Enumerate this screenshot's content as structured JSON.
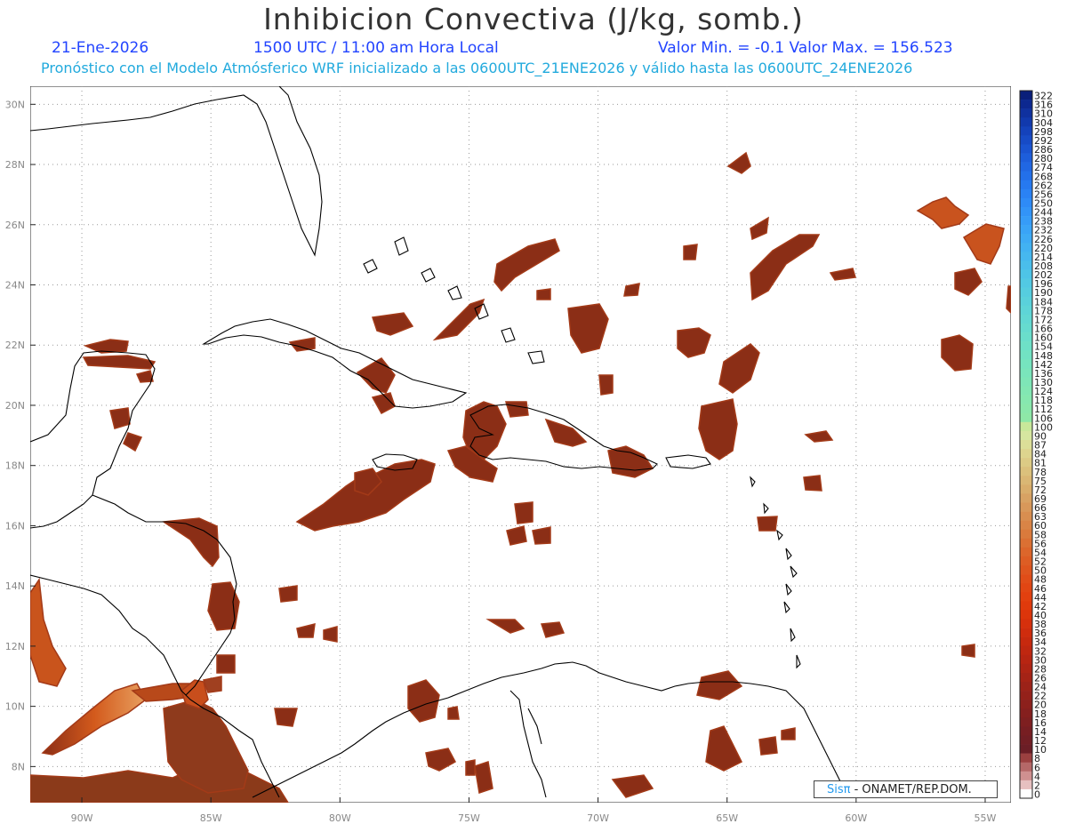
{
  "header": {
    "title": "Inhibicion Convectiva (J/kg, somb.)",
    "date": "21-Ene-2026",
    "time": "1500 UTC / 11:00 am Hora Local",
    "minmax": "Valor Min. = -0.1  Valor Max. = 156.523",
    "subtitle": "Pronóstico con el Modelo Atmósferico WRF inicializado a las 0600UTC_21ENE2026 y válido hasta las  0600UTC_24ENE2026"
  },
  "map": {
    "lon_labels": [
      "90W",
      "85W",
      "80W",
      "75W",
      "70W",
      "65W",
      "60W",
      "55W"
    ],
    "lon_values": [
      -90,
      -85,
      -80,
      -75,
      -70,
      -65,
      -60,
      -55
    ],
    "lat_labels": [
      "8N",
      "10N",
      "12N",
      "14N",
      "16N",
      "18N",
      "20N",
      "22N",
      "24N",
      "26N",
      "28N",
      "30N"
    ],
    "lat_values": [
      8,
      10,
      12,
      14,
      16,
      18,
      20,
      22,
      24,
      26,
      28,
      30
    ],
    "lon_range": [
      -92,
      -54
    ],
    "lat_range": [
      6.8,
      30.6
    ],
    "grid": "dotted"
  },
  "legend": {
    "labels": [
      "322",
      "316",
      "310",
      "304",
      "298",
      "292",
      "286",
      "280",
      "274",
      "268",
      "262",
      "256",
      "250",
      "244",
      "238",
      "232",
      "226",
      "220",
      "214",
      "208",
      "202",
      "196",
      "190",
      "184",
      "178",
      "172",
      "166",
      "160",
      "154",
      "148",
      "142",
      "136",
      "130",
      "124",
      "118",
      "112",
      "106",
      "100",
      "90",
      "87",
      "84",
      "81",
      "78",
      "75",
      "72",
      "69",
      "66",
      "63",
      "60",
      "58",
      "56",
      "54",
      "52",
      "50",
      "48",
      "46",
      "44",
      "42",
      "40",
      "38",
      "36",
      "34",
      "32",
      "30",
      "28",
      "26",
      "24",
      "22",
      "20",
      "18",
      "16",
      "14",
      "12",
      "10",
      "8",
      "6",
      "4",
      "2",
      "0"
    ],
    "colors": [
      "#0a1f7a",
      "#0c2890",
      "#0f319f",
      "#1139ad",
      "#1442bb",
      "#174bc6",
      "#1a54d1",
      "#1d5edb",
      "#2067e3",
      "#2370ea",
      "#2679f0",
      "#2a82f4",
      "#2e8bf7",
      "#3294f8",
      "#369cf8",
      "#3aa4f7",
      "#3eabf5",
      "#42b2f2",
      "#46b8ef",
      "#4abeeb",
      "#4ec4e7",
      "#52c9e3",
      "#56cddf",
      "#5ad1db",
      "#5ed5d7",
      "#62d8d3",
      "#66dbcf",
      "#6adecb",
      "#6ee0c7",
      "#72e2c3",
      "#76e4bf",
      "#7ae5bb",
      "#7ee6b7",
      "#82e7b3",
      "#86e8af",
      "#8ae8ab",
      "#8ee8a7",
      "#c8e89a",
      "#d6e6a0",
      "#dcde98",
      "#ddd48e",
      "#dccb85",
      "#dbc17c",
      "#dab774",
      "#d9ad6b",
      "#d8a263",
      "#d8985a",
      "#d88e50",
      "#d98446",
      "#da7a3c",
      "#db7033",
      "#dc662b",
      "#dd5d24",
      "#de551e",
      "#e04d18",
      "#e14613",
      "#e2400f",
      "#e03a0c",
      "#dc350b",
      "#d6300c",
      "#cf2c0d",
      "#c7290e",
      "#bf2710",
      "#b72512",
      "#ae2414",
      "#a52316",
      "#9c2218",
      "#94211a",
      "#8c201c",
      "#851f1e",
      "#7e1f20",
      "#771e22",
      "#711e24",
      "#6b1e26",
      "#9b4040",
      "#b56868",
      "#cf9090",
      "#e6c0c0",
      "#ffffff"
    ]
  },
  "colors": {
    "cin_low": "#8b2e16",
    "cin_mid": "#d35a1c",
    "cin_high": "#f0d070",
    "cin_peak": "#7fe6d8",
    "coast": "#000000",
    "grid": "#999999"
  },
  "credit": {
    "brand": "Sisπ",
    "text": " - ONAMET/REP.DOM."
  }
}
